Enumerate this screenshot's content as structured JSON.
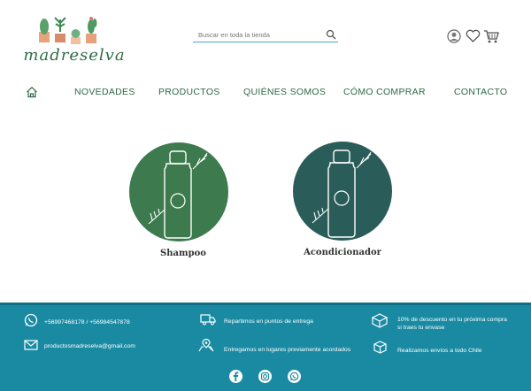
{
  "brand": {
    "name": "madreselva"
  },
  "search": {
    "placeholder": "Buscar en toda la tienda"
  },
  "header_icons": [
    "user-icon",
    "heart-icon",
    "cart-icon"
  ],
  "nav": {
    "home_icon": "home-icon",
    "items": [
      {
        "label": "NOVEDADES"
      },
      {
        "label": "PRODUCTOS"
      },
      {
        "label": "QUIÉNES SOMOS"
      },
      {
        "label": "CÓMO COMPRAR"
      },
      {
        "label": "CONTACTO"
      }
    ]
  },
  "categories": [
    {
      "label": "Shampoo",
      "badge": "s",
      "color": "#3d7b4e"
    },
    {
      "label": "Acondicionador",
      "badge": "a",
      "color": "#2a5d59"
    }
  ],
  "footer": {
    "phone": "+56997468178 / +56984547878",
    "email": "productosmadreselva@gmail.com",
    "delivery_points": "Repartimos en puntos de entrega",
    "delivery_places": "Entregamos en lugares previamente acordados",
    "discount_line1": "10% de descuento en tu próxima compra",
    "discount_line2": "si traes tu envase",
    "shipping": "Realizamos envíos a todo Chile",
    "social_icons": [
      "facebook-icon",
      "instagram-icon",
      "whatsapp-icon"
    ]
  },
  "colors": {
    "accent": "#2f6e46",
    "footer": "#1a8aa3",
    "search_line": "#4aa8c8"
  }
}
